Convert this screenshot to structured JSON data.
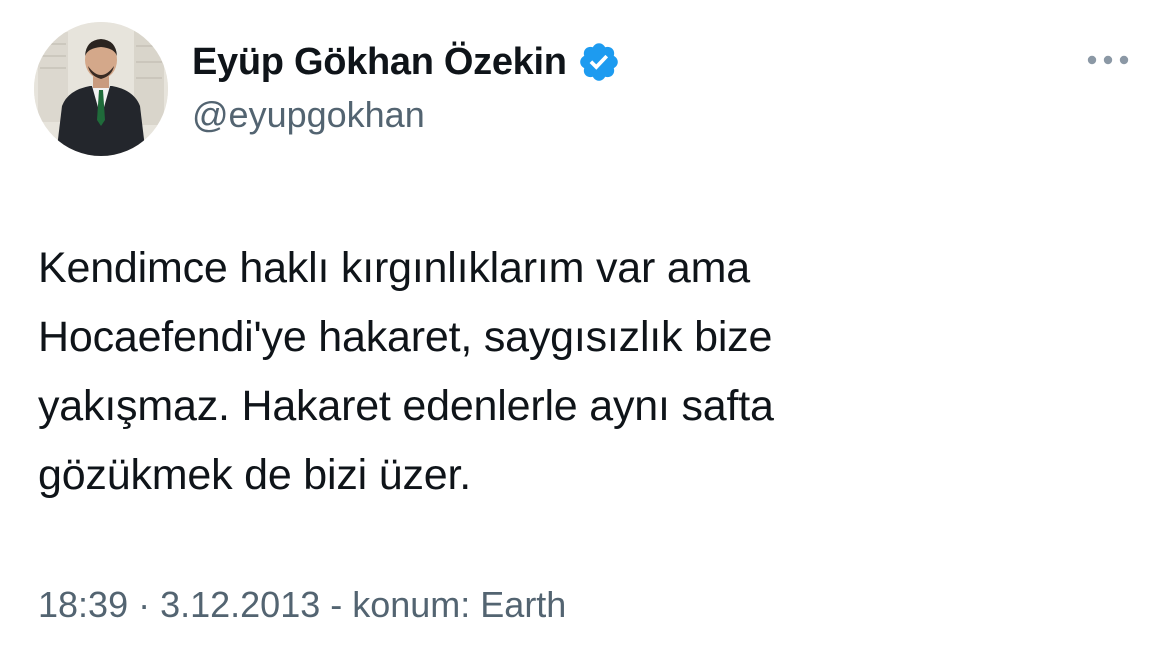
{
  "author": {
    "display_name": "Eyüp Gökhan Özekin",
    "handle": "@eyupgokhan",
    "verified_icon": "verified-badge-icon",
    "avatar_icon": "profile-photo"
  },
  "menu": {
    "more_icon": "more-horizontal-icon"
  },
  "tweet": {
    "text": "Kendimce haklı kırgınlıklarım var ama\nHocaefendi'ye hakaret, saygısızlık bize\nyakışmaz. Hakaret edenlerle aynı safta\ngözükmek de bizi üzer.",
    "meta": "18:39 · 3.12.2013 - konum: Earth"
  },
  "colors": {
    "text_primary": "#0f1419",
    "text_secondary": "#536471",
    "verified_blue": "#1d9bf0",
    "background": "#ffffff"
  }
}
